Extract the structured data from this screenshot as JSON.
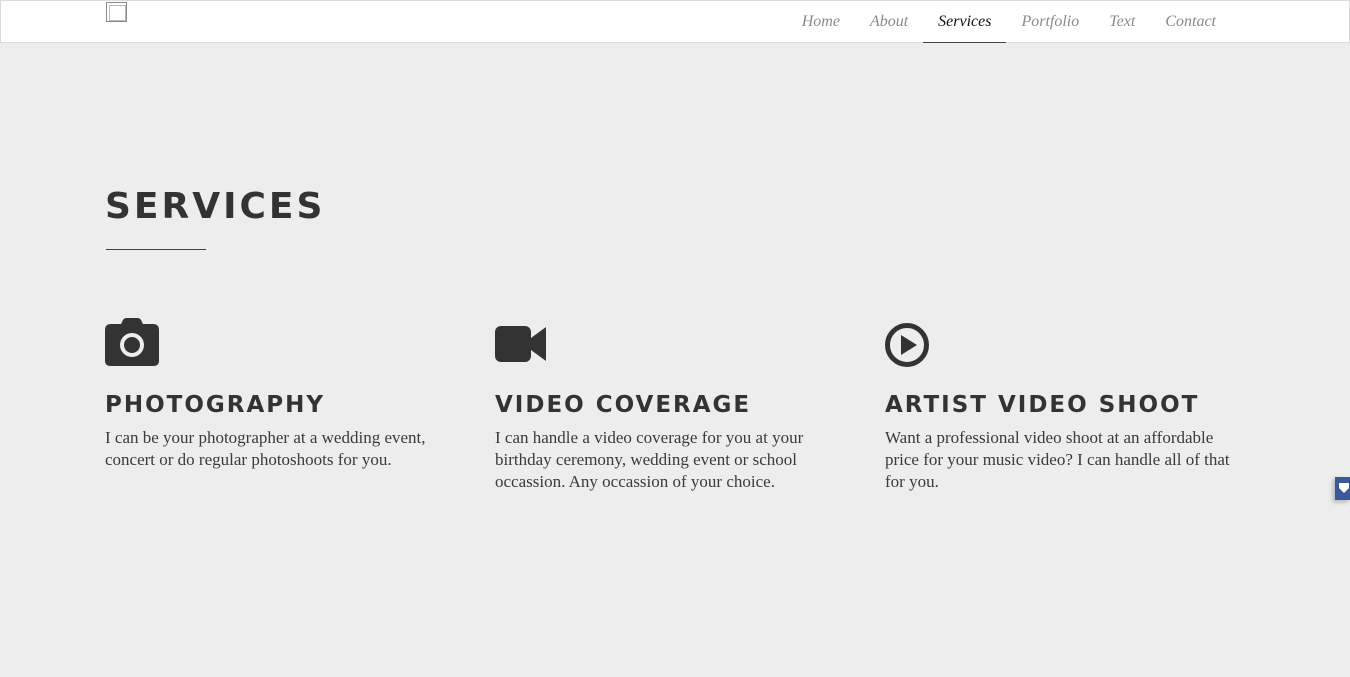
{
  "nav": {
    "items": [
      {
        "label": "Home"
      },
      {
        "label": "About"
      },
      {
        "label": "Services",
        "active": true
      },
      {
        "label": "Portfolio"
      },
      {
        "label": "Text"
      },
      {
        "label": "Contact"
      }
    ]
  },
  "section": {
    "title": "SERVICES"
  },
  "services": [
    {
      "icon": "camera-icon",
      "title": "PHOTOGRAPHY",
      "description": "I can be your photographer at a wedding event, concert or do regular photoshoots for you."
    },
    {
      "icon": "video-camera-icon",
      "title": "VIDEO COVERAGE",
      "description": "I can handle a video coverage for you at your birthday ceremony, wedding event or school occassion. Any occassion of your choice."
    },
    {
      "icon": "play-circle-icon",
      "title": "ARTIST VIDEO SHOOT",
      "description": "Want a professional video shoot at an affordable price for your music video? I can handle all of that for you."
    }
  ],
  "colors": {
    "background": "#ededed",
    "navbar": "#ffffff",
    "text_dark": "#333333",
    "nav_inactive": "#8a8a8a",
    "side_tab": "#3b5998"
  }
}
